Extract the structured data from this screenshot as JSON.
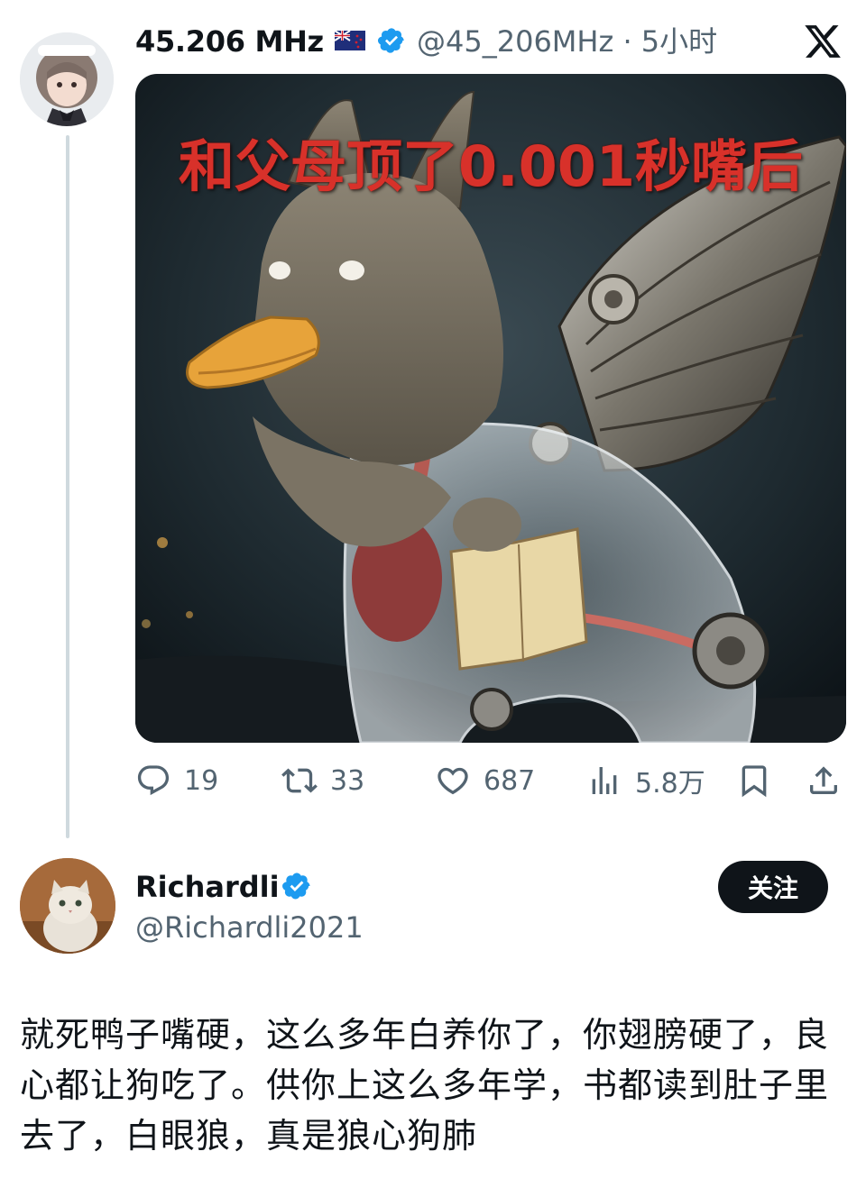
{
  "tweet": {
    "display_name": "45.206 MHz",
    "handle_time": "@45_206MHz · 5小时",
    "media_caption": "和父母顶了0.001秒嘴后",
    "stats": {
      "replies": "19",
      "retweets": "33",
      "likes": "687",
      "views": "5.8万"
    }
  },
  "reply_user": {
    "name": "Richardli",
    "handle": "@Richardli2021",
    "follow_label": "关注"
  },
  "body_text": "就死鸭子嘴硬，这么多年白养你了，你翅膀硬了，良心都让狗吃了。供你上这么多年学，书都读到肚子里去了，白眼狼，真是狼心狗肺",
  "icons": [
    "flag-icon",
    "verified-icon",
    "x-logo-icon",
    "reply-icon",
    "retweet-icon",
    "like-icon",
    "views-icon",
    "bookmark-icon",
    "share-icon"
  ],
  "colors": {
    "verified": "#1d9bf0",
    "secondary_text": "#536471",
    "caption_red": "#d8312a"
  }
}
